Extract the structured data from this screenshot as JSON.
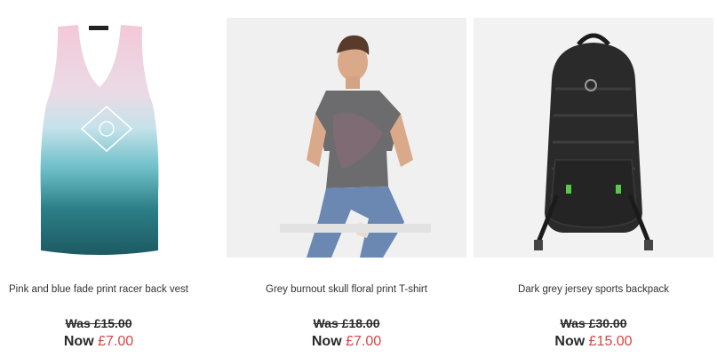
{
  "products": [
    {
      "name": "Pink and blue fade print racer back vest",
      "was_price": "Was £15.00",
      "now_label": "Now",
      "now_price": "£7.00",
      "image_icon": "vest-product-image"
    },
    {
      "name": "Grey burnout skull floral print T-shirt",
      "was_price": "Was £18.00",
      "now_label": "Now",
      "now_price": "£7.00",
      "image_icon": "tshirt-model-product-image"
    },
    {
      "name": "Dark grey jersey sports backpack",
      "was_price": "Was £30.00",
      "now_label": "Now",
      "now_price": "£15.00",
      "image_icon": "backpack-product-image"
    }
  ],
  "colors": {
    "sale_price": "#d64545",
    "text": "#333333",
    "image_bg": "#f2f2f2"
  }
}
